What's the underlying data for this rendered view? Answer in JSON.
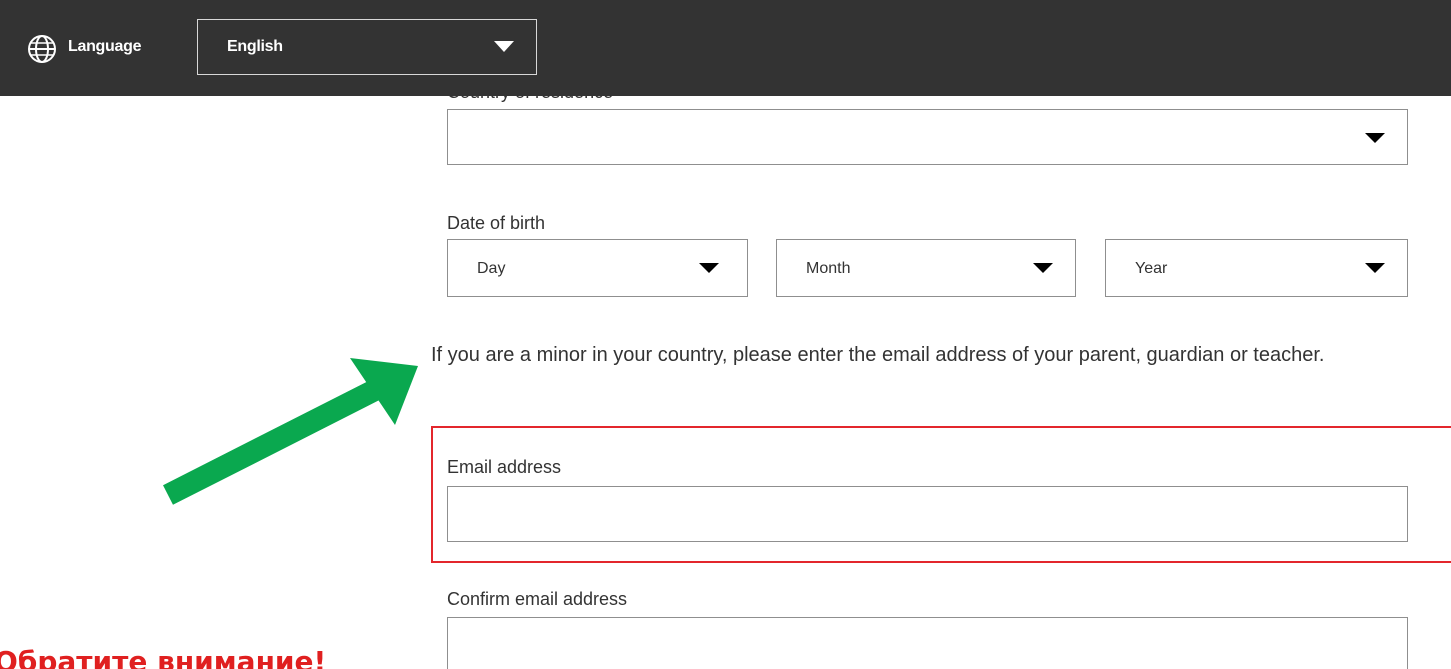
{
  "header": {
    "language_label": "Language",
    "language_value": "English",
    "icon": "globe-icon"
  },
  "form": {
    "country_label": "Country of residence",
    "country_value": "",
    "dob_label": "Date of birth",
    "dob": {
      "day": "Day",
      "month": "Month",
      "year": "Year"
    },
    "minor_notice": "If you are a minor in your country, please enter the email address of your parent, guardian or teacher.",
    "email_label": "Email address",
    "email_value": "",
    "confirm_email_label": "Confirm email address",
    "confirm_email_value": ""
  },
  "annotation": {
    "warning_text": "Обратите внимание!",
    "arrow_color": "#0aa84f",
    "highlight_color": "#e3262c"
  }
}
